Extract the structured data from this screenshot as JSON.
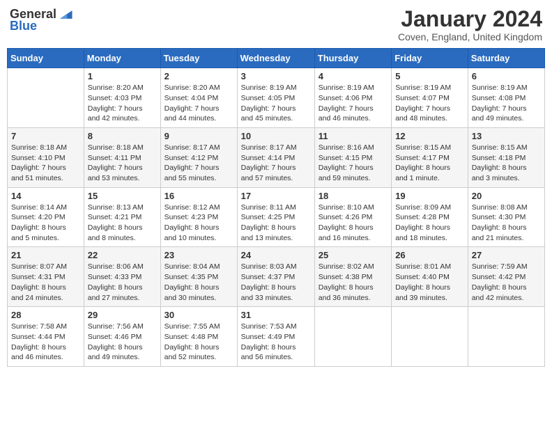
{
  "logo": {
    "general": "General",
    "blue": "Blue"
  },
  "title": "January 2024",
  "subtitle": "Coven, England, United Kingdom",
  "days_header": [
    "Sunday",
    "Monday",
    "Tuesday",
    "Wednesday",
    "Thursday",
    "Friday",
    "Saturday"
  ],
  "weeks": [
    [
      {
        "num": "",
        "info": ""
      },
      {
        "num": "1",
        "info": "Sunrise: 8:20 AM\nSunset: 4:03 PM\nDaylight: 7 hours\nand 42 minutes."
      },
      {
        "num": "2",
        "info": "Sunrise: 8:20 AM\nSunset: 4:04 PM\nDaylight: 7 hours\nand 44 minutes."
      },
      {
        "num": "3",
        "info": "Sunrise: 8:19 AM\nSunset: 4:05 PM\nDaylight: 7 hours\nand 45 minutes."
      },
      {
        "num": "4",
        "info": "Sunrise: 8:19 AM\nSunset: 4:06 PM\nDaylight: 7 hours\nand 46 minutes."
      },
      {
        "num": "5",
        "info": "Sunrise: 8:19 AM\nSunset: 4:07 PM\nDaylight: 7 hours\nand 48 minutes."
      },
      {
        "num": "6",
        "info": "Sunrise: 8:19 AM\nSunset: 4:08 PM\nDaylight: 7 hours\nand 49 minutes."
      }
    ],
    [
      {
        "num": "7",
        "info": "Sunrise: 8:18 AM\nSunset: 4:10 PM\nDaylight: 7 hours\nand 51 minutes."
      },
      {
        "num": "8",
        "info": "Sunrise: 8:18 AM\nSunset: 4:11 PM\nDaylight: 7 hours\nand 53 minutes."
      },
      {
        "num": "9",
        "info": "Sunrise: 8:17 AM\nSunset: 4:12 PM\nDaylight: 7 hours\nand 55 minutes."
      },
      {
        "num": "10",
        "info": "Sunrise: 8:17 AM\nSunset: 4:14 PM\nDaylight: 7 hours\nand 57 minutes."
      },
      {
        "num": "11",
        "info": "Sunrise: 8:16 AM\nSunset: 4:15 PM\nDaylight: 7 hours\nand 59 minutes."
      },
      {
        "num": "12",
        "info": "Sunrise: 8:15 AM\nSunset: 4:17 PM\nDaylight: 8 hours\nand 1 minute."
      },
      {
        "num": "13",
        "info": "Sunrise: 8:15 AM\nSunset: 4:18 PM\nDaylight: 8 hours\nand 3 minutes."
      }
    ],
    [
      {
        "num": "14",
        "info": "Sunrise: 8:14 AM\nSunset: 4:20 PM\nDaylight: 8 hours\nand 5 minutes."
      },
      {
        "num": "15",
        "info": "Sunrise: 8:13 AM\nSunset: 4:21 PM\nDaylight: 8 hours\nand 8 minutes."
      },
      {
        "num": "16",
        "info": "Sunrise: 8:12 AM\nSunset: 4:23 PM\nDaylight: 8 hours\nand 10 minutes."
      },
      {
        "num": "17",
        "info": "Sunrise: 8:11 AM\nSunset: 4:25 PM\nDaylight: 8 hours\nand 13 minutes."
      },
      {
        "num": "18",
        "info": "Sunrise: 8:10 AM\nSunset: 4:26 PM\nDaylight: 8 hours\nand 16 minutes."
      },
      {
        "num": "19",
        "info": "Sunrise: 8:09 AM\nSunset: 4:28 PM\nDaylight: 8 hours\nand 18 minutes."
      },
      {
        "num": "20",
        "info": "Sunrise: 8:08 AM\nSunset: 4:30 PM\nDaylight: 8 hours\nand 21 minutes."
      }
    ],
    [
      {
        "num": "21",
        "info": "Sunrise: 8:07 AM\nSunset: 4:31 PM\nDaylight: 8 hours\nand 24 minutes."
      },
      {
        "num": "22",
        "info": "Sunrise: 8:06 AM\nSunset: 4:33 PM\nDaylight: 8 hours\nand 27 minutes."
      },
      {
        "num": "23",
        "info": "Sunrise: 8:04 AM\nSunset: 4:35 PM\nDaylight: 8 hours\nand 30 minutes."
      },
      {
        "num": "24",
        "info": "Sunrise: 8:03 AM\nSunset: 4:37 PM\nDaylight: 8 hours\nand 33 minutes."
      },
      {
        "num": "25",
        "info": "Sunrise: 8:02 AM\nSunset: 4:38 PM\nDaylight: 8 hours\nand 36 minutes."
      },
      {
        "num": "26",
        "info": "Sunrise: 8:01 AM\nSunset: 4:40 PM\nDaylight: 8 hours\nand 39 minutes."
      },
      {
        "num": "27",
        "info": "Sunrise: 7:59 AM\nSunset: 4:42 PM\nDaylight: 8 hours\nand 42 minutes."
      }
    ],
    [
      {
        "num": "28",
        "info": "Sunrise: 7:58 AM\nSunset: 4:44 PM\nDaylight: 8 hours\nand 46 minutes."
      },
      {
        "num": "29",
        "info": "Sunrise: 7:56 AM\nSunset: 4:46 PM\nDaylight: 8 hours\nand 49 minutes."
      },
      {
        "num": "30",
        "info": "Sunrise: 7:55 AM\nSunset: 4:48 PM\nDaylight: 8 hours\nand 52 minutes."
      },
      {
        "num": "31",
        "info": "Sunrise: 7:53 AM\nSunset: 4:49 PM\nDaylight: 8 hours\nand 56 minutes."
      },
      {
        "num": "",
        "info": ""
      },
      {
        "num": "",
        "info": ""
      },
      {
        "num": "",
        "info": ""
      }
    ]
  ]
}
